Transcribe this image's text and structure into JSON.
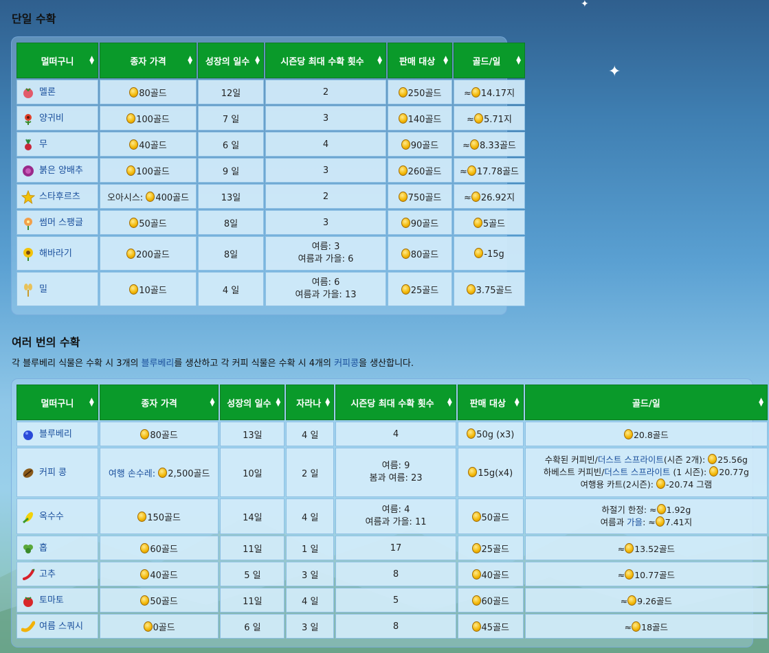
{
  "single": {
    "title": "단일 수확",
    "headers": [
      "멀떠구니",
      "종자 가격",
      "성장의 일수",
      "시즌당 최대 수확 횟수",
      "판매 대상",
      "골드/일"
    ],
    "rows": [
      {
        "name": "멜론",
        "seed": "80골드",
        "days": "12일",
        "harvests": "2",
        "sell": "250골드",
        "gpd": "14.17지",
        "approx": true
      },
      {
        "name": "양귀비",
        "seed": "100골드",
        "days": "7 일",
        "harvests": "3",
        "sell": "140골드",
        "gpd": "5.71지",
        "approx": true
      },
      {
        "name": "무",
        "seed": "40골드",
        "days": "6 일",
        "harvests": "4",
        "sell": "90골드",
        "gpd": "8.33골드",
        "approx": true
      },
      {
        "name": "붉은 양배추",
        "seed": "100골드",
        "days": "9 일",
        "harvests": "3",
        "sell": "260골드",
        "gpd": "17.78골드",
        "approx": true
      },
      {
        "name": "스타후르츠",
        "seed_prefix": "오아시스:",
        "seed": "400골드",
        "days": "13일",
        "harvests": "2",
        "sell": "750골드",
        "gpd": "26.92지",
        "approx": true
      },
      {
        "name": "썸머 스팽글",
        "seed": "50골드",
        "days": "8일",
        "harvests": "3",
        "sell": "90골드",
        "gpd": "5골드",
        "approx": false
      },
      {
        "name": "해바라기",
        "seed": "200골드",
        "days": "8일",
        "harvests_l1": "여름: 3",
        "harvests_l2": "여름과 가을: 6",
        "sell": "80골드",
        "gpd": "-15g",
        "approx": false
      },
      {
        "name": "밀",
        "seed": "10골드",
        "days": "4 일",
        "harvests_l1": "여름: 6",
        "harvests_l2": "여름과 가을: 13",
        "sell": "25골드",
        "gpd": "3.75골드",
        "approx": false
      }
    ]
  },
  "multi": {
    "title": "여러 번의 수확",
    "desc_1": "각 블루베리 식물은 수확 시 3개의 ",
    "desc_link1": "블루베리",
    "desc_2": "를 생산하고 각 커피 식물은 수확 시 4개의 ",
    "desc_link2": "커피콩",
    "desc_3": "을 생산합니다.",
    "headers": [
      "멀떠구니",
      "종자 가격",
      "성장의 일수",
      "자라나",
      "시즌당 최대 수확 횟수",
      "판매 대상",
      "골드/일"
    ],
    "rows": [
      {
        "name": "블루베리",
        "seed": "80골드",
        "days": "13일",
        "regrow": "4 일",
        "harvests": "4",
        "sell": "50g (x3)",
        "gpd": "20.8골드"
      },
      {
        "name": "커피 콩",
        "seed_prefix": "여행 손수레:",
        "seed": "2,500골드",
        "days": "10일",
        "regrow": "2 일",
        "harvests_l1": "여름: 9",
        "harvests_l2": "봄과 여름: 23",
        "sell": "15g(x4)",
        "gpd_l1a": "수확된 커피빈/",
        "gpd_l1b": "더스트 스프라이트",
        "gpd_l1c": "(시즌 2개):",
        "gpd_l1v": "25.56g",
        "gpd_l2a": "하베스트 커피빈/",
        "gpd_l2b": "더스트 스프라이트",
        "gpd_l2c": " (1 시즌):",
        "gpd_l2v": "20.77g",
        "gpd_l3a": "여행용 카트(2시즌):",
        "gpd_l3v": "-20.74 그램"
      },
      {
        "name": "옥수수",
        "seed": "150골드",
        "days": "14일",
        "regrow": "4 일",
        "harvests_l1": "여름: 4",
        "harvests_l2": "여름과 가을: 11",
        "sell": "50골드",
        "gpd_l1a": "하절기 한정: ≈",
        "gpd_l1v": "1.92g",
        "gpd_l2a": "여름과 ",
        "gpd_l2b": "가을",
        "gpd_l2c": ": ≈",
        "gpd_l2v": "7.41지"
      },
      {
        "name": "홉",
        "seed": "60골드",
        "days": "11일",
        "regrow": "1 일",
        "harvests": "17",
        "sell": "25골드",
        "gpd": "13.52골드"
      },
      {
        "name": "고추",
        "seed": "40골드",
        "days": "5 일",
        "regrow": "3 일",
        "harvests": "8",
        "sell": "40골드",
        "gpd": "10.77골드"
      },
      {
        "name": "토마토",
        "seed": "50골드",
        "days": "11일",
        "regrow": "4 일",
        "harvests": "5",
        "sell": "60골드",
        "gpd": "9.26골드"
      },
      {
        "name": "여름 스쿼시",
        "seed": "0골드",
        "days": "6 일",
        "regrow": "3 일",
        "harvests": "8",
        "sell": "45골드",
        "gpd": "18골드"
      }
    ]
  },
  "approx_symbol": "≈",
  "icons_single": [
    "melon-icon",
    "poppy-icon",
    "radish-icon",
    "red-cabbage-icon",
    "starfruit-icon",
    "summer-spangle-icon",
    "sunflower-icon",
    "wheat-icon"
  ],
  "icons_multi": [
    "blueberry-icon",
    "coffee-bean-icon",
    "corn-icon",
    "hops-icon",
    "hot-pepper-icon",
    "tomato-icon",
    "summer-squash-icon"
  ]
}
